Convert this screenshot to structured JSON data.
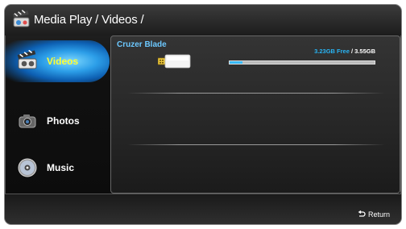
{
  "header": {
    "title": "Media Play / Videos /",
    "icon": "media-play-clapper-icon"
  },
  "sidebar": {
    "items": [
      {
        "label": "Videos",
        "icon": "clapperboard-icon",
        "selected": true
      },
      {
        "label": "Photos",
        "icon": "camera-icon",
        "selected": false
      },
      {
        "label": "Music",
        "icon": "cd-icon",
        "selected": false
      }
    ]
  },
  "device": {
    "name": "Cruzer Blade",
    "icon": "usb-drive-icon",
    "free": "3.23GB Free",
    "separator": " / ",
    "total": "3.55GB",
    "used_fraction": 0.09
  },
  "footer": {
    "return_label": "Return",
    "return_icon": "return-arrow-icon"
  },
  "colors": {
    "accent_blue": "#28b4f4",
    "selected_label": "#ffff33",
    "device_name": "#6cc8ff"
  }
}
